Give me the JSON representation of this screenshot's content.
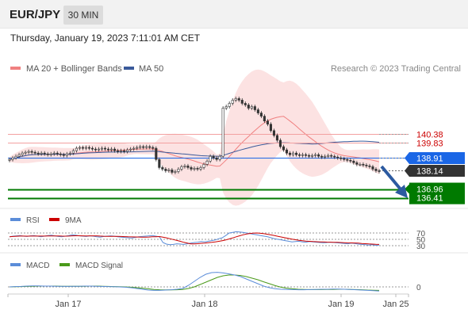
{
  "header": {
    "symbol": "EUR/JPY",
    "timeframe": "30 MIN"
  },
  "timestamp": "Thursday, January 19, 2023 7:11:01 AM CET",
  "colors": {
    "up": "#1e9a1e",
    "down": "#c0392b",
    "bollinger": "#f08080",
    "bollinger_fill": "#fbd3d3",
    "ma50": "#3a5a9a",
    "resistance": "#cc0000",
    "pivot": "#1a66e6",
    "support": "#007a00",
    "last": "#333333",
    "rsi": "#5b8dd9",
    "rsi_ma": "#cc0000",
    "macd": "#5b8dd9",
    "macd_signal": "#4a9a1a",
    "arrow": "#2c5aa0"
  },
  "chart_data": {
    "type": "line",
    "subtype": "candlestick",
    "x_ticks": [
      "Jan 17",
      "Jan 18",
      "Jan 19",
      "Jan 25"
    ],
    "price_range": [
      135.8,
      144.0
    ],
    "legend": [
      {
        "label": "MA 20 + Bollinger Bands",
        "color": "#f08080"
      },
      {
        "label": "MA 50",
        "color": "#3a5a9a"
      }
    ],
    "attribution": "Research © 2023 Trading Central",
    "levels": [
      {
        "label": "140.38",
        "value": 140.38,
        "kind": "resistance"
      },
      {
        "label": "139.83",
        "value": 139.83,
        "kind": "resistance"
      },
      {
        "label": "138.91",
        "value": 138.91,
        "kind": "pivot"
      },
      {
        "label": "138.14",
        "value": 138.14,
        "kind": "last"
      },
      {
        "label": "136.96",
        "value": 136.96,
        "kind": "support"
      },
      {
        "label": "136.41",
        "value": 136.41,
        "kind": "support"
      }
    ],
    "price_series": [
      138.8,
      138.9,
      139.0,
      139.1,
      139.2,
      139.25,
      139.3,
      139.25,
      139.2,
      139.15,
      139.2,
      139.15,
      139.1,
      139.15,
      139.2,
      139.15,
      139.1,
      139.05,
      139.15,
      139.2,
      139.35,
      139.5,
      139.55,
      139.5,
      139.55,
      139.5,
      139.45,
      139.4,
      139.45,
      139.5,
      139.45,
      139.4,
      139.45,
      139.35,
      139.3,
      139.35,
      139.3,
      139.4,
      139.45,
      139.5,
      139.55,
      139.6,
      139.55,
      139.6,
      139.55,
      139.5,
      138.8,
      138.3,
      138.2,
      138.1,
      138.15,
      138.0,
      138.05,
      138.2,
      138.35,
      138.4,
      138.3,
      138.2,
      138.25,
      138.2,
      138.3,
      138.5,
      138.7,
      139.0,
      138.9,
      138.8,
      139.0,
      142.0,
      142.1,
      142.3,
      142.5,
      142.6,
      142.5,
      142.3,
      142.2,
      142.0,
      142.1,
      141.9,
      141.7,
      141.5,
      141.2,
      141.0,
      140.6,
      140.3,
      140.0,
      139.6,
      139.4,
      139.2,
      139.1,
      139.2,
      139.1,
      139.05,
      139.1,
      139.05,
      139.0,
      139.05,
      139.1,
      139.0,
      138.95,
      139.0,
      139.05,
      139.0,
      138.95,
      138.9,
      138.85,
      138.8,
      138.75,
      138.7,
      138.6,
      138.5,
      138.5,
      138.45,
      138.4,
      138.35,
      138.2,
      138.1,
      138.05
    ],
    "rsi": {
      "label": "RSI",
      "ma_label": "9MA",
      "levels": [
        70,
        50,
        30
      ],
      "values": [
        58,
        60,
        61,
        62,
        60,
        59,
        61,
        62,
        60,
        58,
        60,
        62,
        63,
        61,
        59,
        58,
        60,
        62,
        64,
        63,
        61,
        60,
        59,
        61,
        60,
        58,
        57,
        59,
        60,
        61,
        60,
        58,
        57,
        56,
        55,
        54,
        56,
        58,
        59,
        60,
        61,
        62,
        60,
        58,
        40,
        35,
        33,
        34,
        36,
        35,
        34,
        36,
        38,
        40,
        41,
        43,
        42,
        44,
        46,
        48,
        52,
        55,
        62,
        70,
        72,
        74,
        73,
        72,
        70,
        68,
        66,
        64,
        62,
        60,
        58,
        55,
        52,
        50,
        48,
        46,
        44,
        42,
        43,
        44,
        42,
        41,
        43,
        42,
        41,
        40,
        39,
        40,
        41,
        40,
        39,
        38,
        37,
        36,
        38,
        37,
        35,
        34,
        33,
        32,
        33,
        31,
        32
      ]
    },
    "macd": {
      "label": "MACD",
      "signal_label": "MACD Signal",
      "zero_label": "0",
      "macd": [
        0.0,
        0.02,
        0.03,
        0.05,
        0.06,
        0.06,
        0.05,
        0.05,
        0.04,
        0.04,
        0.03,
        0.04,
        0.04,
        0.05,
        0.05,
        0.04,
        0.03,
        0.02,
        0.01,
        0.0,
        -0.02,
        -0.05,
        -0.1,
        -0.15,
        -0.2,
        -0.22,
        -0.22,
        -0.2,
        -0.18,
        -0.15,
        -0.1,
        0.1,
        0.35,
        0.6,
        0.8,
        0.9,
        0.92,
        0.88,
        0.82,
        0.75,
        0.65,
        0.5,
        0.35,
        0.2,
        0.05,
        -0.05,
        -0.12,
        -0.15,
        -0.16,
        -0.17,
        -0.18,
        -0.18,
        -0.17,
        -0.16,
        -0.15,
        -0.15,
        -0.14,
        -0.14,
        -0.15,
        -0.16,
        -0.18,
        -0.2,
        -0.22,
        -0.24,
        -0.26
      ],
      "signal": [
        0.0,
        0.01,
        0.02,
        0.03,
        0.04,
        0.05,
        0.05,
        0.05,
        0.05,
        0.04,
        0.04,
        0.04,
        0.04,
        0.04,
        0.05,
        0.05,
        0.04,
        0.03,
        0.02,
        0.01,
        0.0,
        -0.02,
        -0.05,
        -0.08,
        -0.12,
        -0.16,
        -0.18,
        -0.19,
        -0.19,
        -0.18,
        -0.16,
        -0.1,
        0.0,
        0.15,
        0.3,
        0.45,
        0.6,
        0.7,
        0.75,
        0.75,
        0.72,
        0.65,
        0.55,
        0.45,
        0.32,
        0.2,
        0.08,
        -0.02,
        -0.08,
        -0.12,
        -0.15,
        -0.16,
        -0.17,
        -0.17,
        -0.17,
        -0.16,
        -0.16,
        -0.15,
        -0.15,
        -0.16,
        -0.17,
        -0.18,
        -0.2,
        -0.21,
        -0.22
      ]
    }
  }
}
